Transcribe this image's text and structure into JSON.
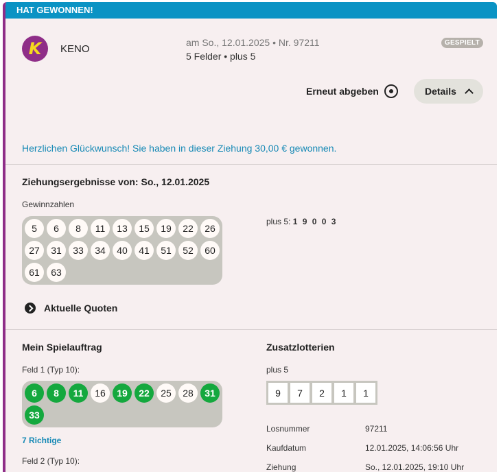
{
  "banner": {
    "text": "HAT GEWONNEN!"
  },
  "game": {
    "logo_letter": "K",
    "name": "KENO",
    "draw_info": "am So., 12.01.2025 • Nr. 97211",
    "fields": "5 Felder • plus 5",
    "status": "GESPIELT"
  },
  "actions": {
    "resubmit": "Erneut abgeben",
    "details": "Details"
  },
  "congrats": "Herzlichen Glückwunsch! Sie haben in dieser Ziehung 30,00 € gewonnen.",
  "results": {
    "title": "Ziehungsergebnisse von: So., 12.01.2025",
    "winning_label": "Gewinnzahlen",
    "winning_numbers": [
      "5",
      "6",
      "8",
      "11",
      "13",
      "15",
      "19",
      "22",
      "26",
      "27",
      "31",
      "33",
      "34",
      "40",
      "41",
      "51",
      "52",
      "60",
      "61",
      "63"
    ],
    "plus5_label": "plus 5:",
    "plus5_value": "1 9 0 0 3",
    "quotes_link": "Aktuelle Quoten"
  },
  "ticket": {
    "title": "Mein Spielauftrag",
    "field1_label": "Feld 1 (Typ 10):",
    "field1_numbers": [
      {
        "n": "6",
        "hit": true
      },
      {
        "n": "8",
        "hit": true
      },
      {
        "n": "11",
        "hit": true
      },
      {
        "n": "16",
        "hit": false
      },
      {
        "n": "19",
        "hit": true
      },
      {
        "n": "22",
        "hit": true
      },
      {
        "n": "25",
        "hit": false
      },
      {
        "n": "28",
        "hit": false
      },
      {
        "n": "31",
        "hit": true
      },
      {
        "n": "33",
        "hit": true
      }
    ],
    "field1_hits": "7 Richtige",
    "field2_label": "Feld 2 (Typ 10):"
  },
  "extras": {
    "title": "Zusatzlotterien",
    "plus5_label": "plus 5",
    "plus5_digits": [
      "9",
      "7",
      "2",
      "1",
      "1"
    ],
    "ticket_number_label": "Losnummer",
    "ticket_number": "97211",
    "purchase_label": "Kaufdatum",
    "purchase_date": "12.01.2025, 14:06:56 Uhr",
    "draw_label": "Ziehung",
    "draw_date": "So., 12.01.2025, 19:10 Uhr"
  },
  "colors": {
    "banner": "#0a93c4",
    "accent": "#8f2e88",
    "hit": "#14a83e",
    "link": "#1689b5"
  }
}
